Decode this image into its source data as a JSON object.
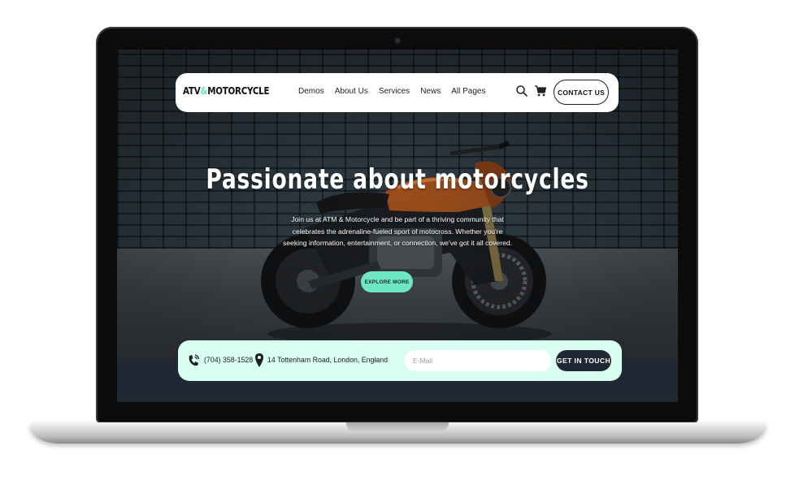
{
  "nav": {
    "logo_part1": "ATV",
    "logo_amp": "&",
    "logo_part2": "MOTORCYCLE",
    "items": [
      {
        "label": "Demos"
      },
      {
        "label": "About Us"
      },
      {
        "label": "Services"
      },
      {
        "label": "News"
      },
      {
        "label": "All Pages"
      }
    ],
    "search_icon": "search-icon",
    "cart_icon": "cart-icon",
    "contact_label": "CONTACT US"
  },
  "hero": {
    "title": "Passionate about motorcycles",
    "description": "Join us at ATM & Motorcycle and be part of a thriving community that celebrates the adrenaline-fueled sport of motocross. Whether you're seeking information, entertainment, or connection, we've got it all covered.",
    "button_label": "EXPLORE MORE"
  },
  "contact_bar": {
    "phone_icon": "phone-icon",
    "phone": "(704) 358-1528",
    "pin_icon": "location-pin-icon",
    "address": "14 Tottenham Road, London, England",
    "email_placeholder": "E-Mail",
    "button_label": "GET IN TOUCH"
  },
  "colors": {
    "accent": "#6fe6c2",
    "dark": "#1f2833",
    "contact_bar_bg": "#d9fff0"
  }
}
